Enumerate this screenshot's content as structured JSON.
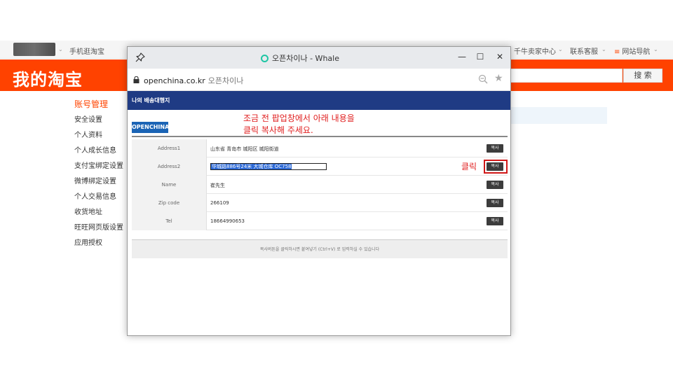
{
  "taobao": {
    "topbar": {
      "mobile_link": "手机逛淘宝",
      "seller_center": "千牛卖家中心",
      "customer_service": "联系客服",
      "site_nav": "网站导航"
    },
    "logo": "我的淘宝",
    "search_button": "搜 索",
    "sidebar": {
      "title": "账号管理",
      "items": [
        "安全设置",
        "个人资料",
        "个人成长信息",
        "支付宝绑定设置",
        "微博绑定设置",
        "个人交易信息",
        "收货地址",
        "旺旺网页版设置",
        "应用授权"
      ]
    }
  },
  "popup": {
    "window_title": "오픈차이나 - Whale",
    "url": "openchina.co.kr",
    "page_title": "오픈차이나",
    "banner": "나의 배송대행지",
    "logo": "OPENCHINA",
    "instruction_line1": "조금 전 팝업창에서 아래 내용을",
    "instruction_line2": "클릭 복사해 주세요.",
    "click_label": "클릭",
    "copy_label": "복사",
    "rows": [
      {
        "label": "Address1",
        "value": "山东省 青岛市 城阳区 城阳街道"
      },
      {
        "label": "Address2",
        "value": "华城路886号24米 大城仓库 OC758",
        "selected": true
      },
      {
        "label": "Name",
        "value": "崔先生"
      },
      {
        "label": "Zip code",
        "value": "266109"
      },
      {
        "label": "Tel",
        "value": "18664990653"
      }
    ],
    "footer": "복사버튼을 클릭하시면 붙여넣기 (Ctrl+V) 로 입력하실 수 있습니다"
  },
  "colors": {
    "taobao_orange": "#ff4200",
    "banner_navy": "#1f3b84",
    "annotation_red": "#e02020",
    "selection_blue": "#2c69d6"
  }
}
